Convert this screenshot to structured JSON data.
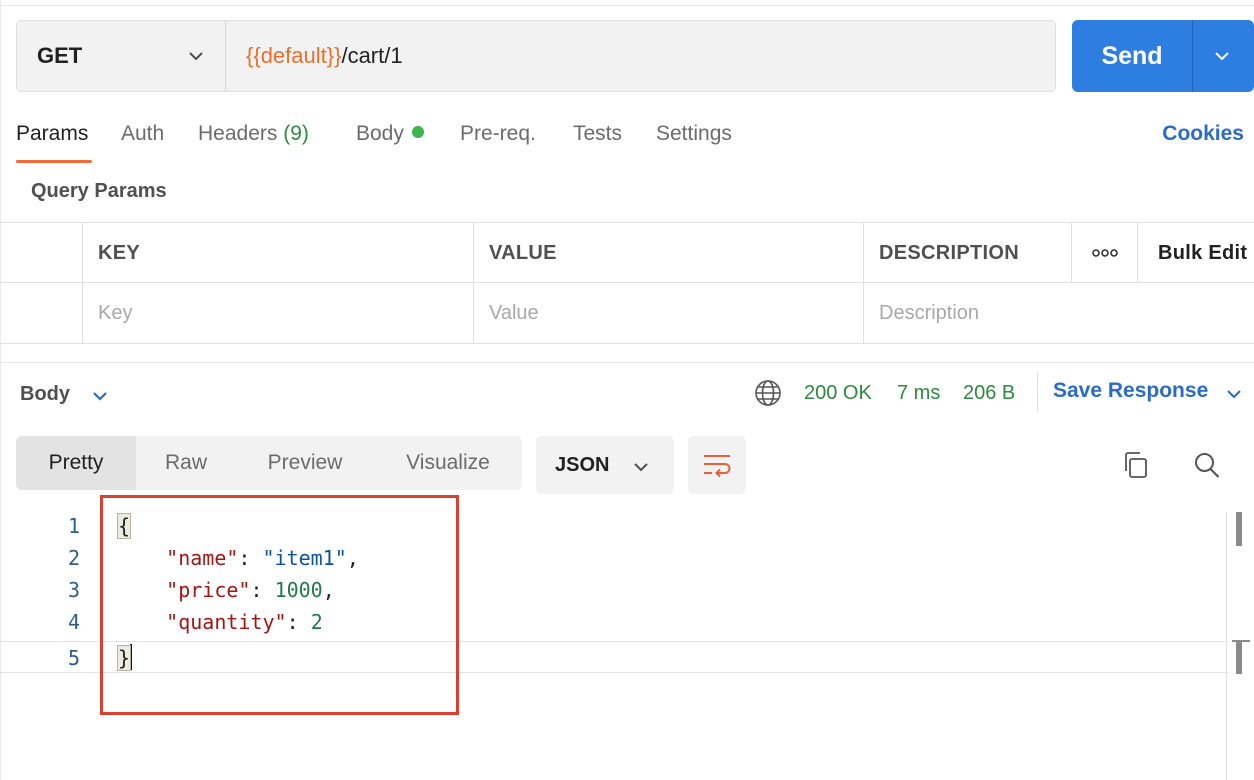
{
  "request": {
    "method": "GET",
    "url_variable": "{{default}}",
    "url_path": "/cart/1",
    "send_label": "Send"
  },
  "tabs": [
    {
      "label": "Params"
    },
    {
      "label": "Auth"
    },
    {
      "label": "Headers",
      "count": "(9)"
    },
    {
      "label": "Body"
    },
    {
      "label": "Pre-req."
    },
    {
      "label": "Tests"
    },
    {
      "label": "Settings"
    }
  ],
  "cookies_label": "Cookies",
  "query_params": {
    "title": "Query Params",
    "headers": {
      "key": "KEY",
      "value": "VALUE",
      "description": "DESCRIPTION",
      "more": "ooo",
      "bulk_edit": "Bulk Edit"
    },
    "placeholders": {
      "key": "Key",
      "value": "Value",
      "description": "Description"
    }
  },
  "response": {
    "section_label": "Body",
    "status": "200 OK",
    "time": "7 ms",
    "size": "206 B",
    "save_label": "Save Response",
    "views": [
      "Pretty",
      "Raw",
      "Preview",
      "Visualize"
    ],
    "format": "JSON",
    "code": {
      "line_numbers": [
        "1",
        "2",
        "3",
        "4",
        "5"
      ],
      "open_brace": "{",
      "close_brace": "}",
      "fields": [
        {
          "key": "\"name\"",
          "value": "\"item1\"",
          "type": "string",
          "trail": ","
        },
        {
          "key": "\"price\"",
          "value": "1000",
          "type": "number",
          "trail": ","
        },
        {
          "key": "\"quantity\"",
          "value": "2",
          "type": "number",
          "trail": ""
        }
      ]
    }
  },
  "colors": {
    "accent": "#2d7ee0",
    "variable": "#e8702a",
    "status_ok": "#2d8a3e",
    "highlight_box": "#d9412e"
  }
}
